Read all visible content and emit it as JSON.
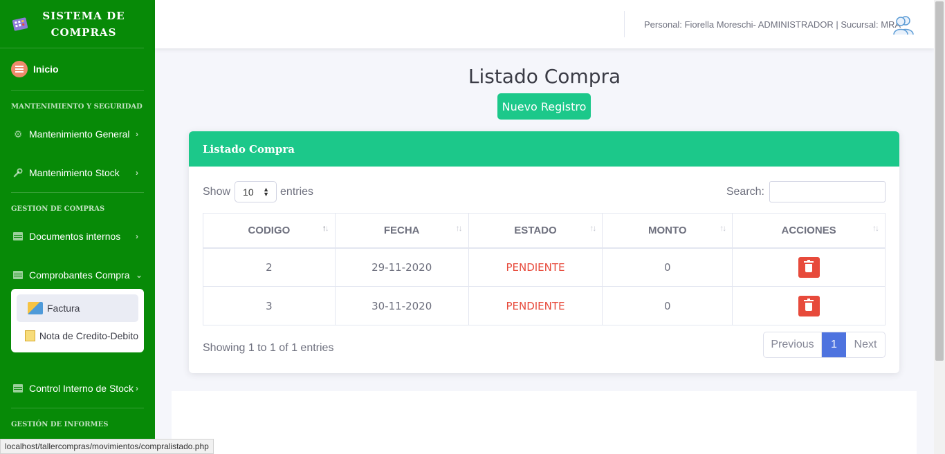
{
  "sidebar": {
    "brand": "SISTEMA DE COMPRAS",
    "home": "Inicio",
    "heading_1": "MANTENIMIENTO Y SEGURIDAD",
    "item_mantenimiento_general": "Mantenimiento General",
    "item_mantenimiento_stock": "Mantenimiento Stock",
    "heading_2": "GESTION DE COMPRAS",
    "item_documentos_internos": "Documentos internos",
    "item_comprobantes_compra": "Comprobantes Compra",
    "sub_factura": "Factura",
    "sub_nota": "Nota de Credito-Debito",
    "item_control_stock": "Control Interno de Stock",
    "heading_3": "GESTIÓN DE INFORMES"
  },
  "topbar": {
    "user_text": "Personal: Fiorella Moreschi- ADMINISTRADOR | Sucursal: MRA"
  },
  "main": {
    "title": "Listado Compra",
    "new_button": "Nuevo Registro",
    "card_title": "Listado Compra",
    "show_label": "Show",
    "entries_value": "10",
    "entries_label": "entries",
    "search_label": "Search:",
    "columns": [
      "CODIGO",
      "FECHA",
      "ESTADO",
      "MONTO",
      "ACCIONES"
    ],
    "rows": [
      {
        "codigo": "2",
        "fecha": "29-11-2020",
        "estado": "PENDIENTE",
        "monto": "0"
      },
      {
        "codigo": "3",
        "fecha": "30-11-2020",
        "estado": "PENDIENTE",
        "monto": "0"
      }
    ],
    "info": "Showing 1 to 1 of 1 entries",
    "pager": {
      "previous": "Previous",
      "page": "1",
      "next": "Next"
    }
  },
  "statusbar": "localhost/tallercompras/movimientos/compralistado.php",
  "colors": {
    "sidebar": "#078a07",
    "accent": "#1cc88a",
    "danger": "#e74a3b",
    "primary": "#4e73df"
  }
}
